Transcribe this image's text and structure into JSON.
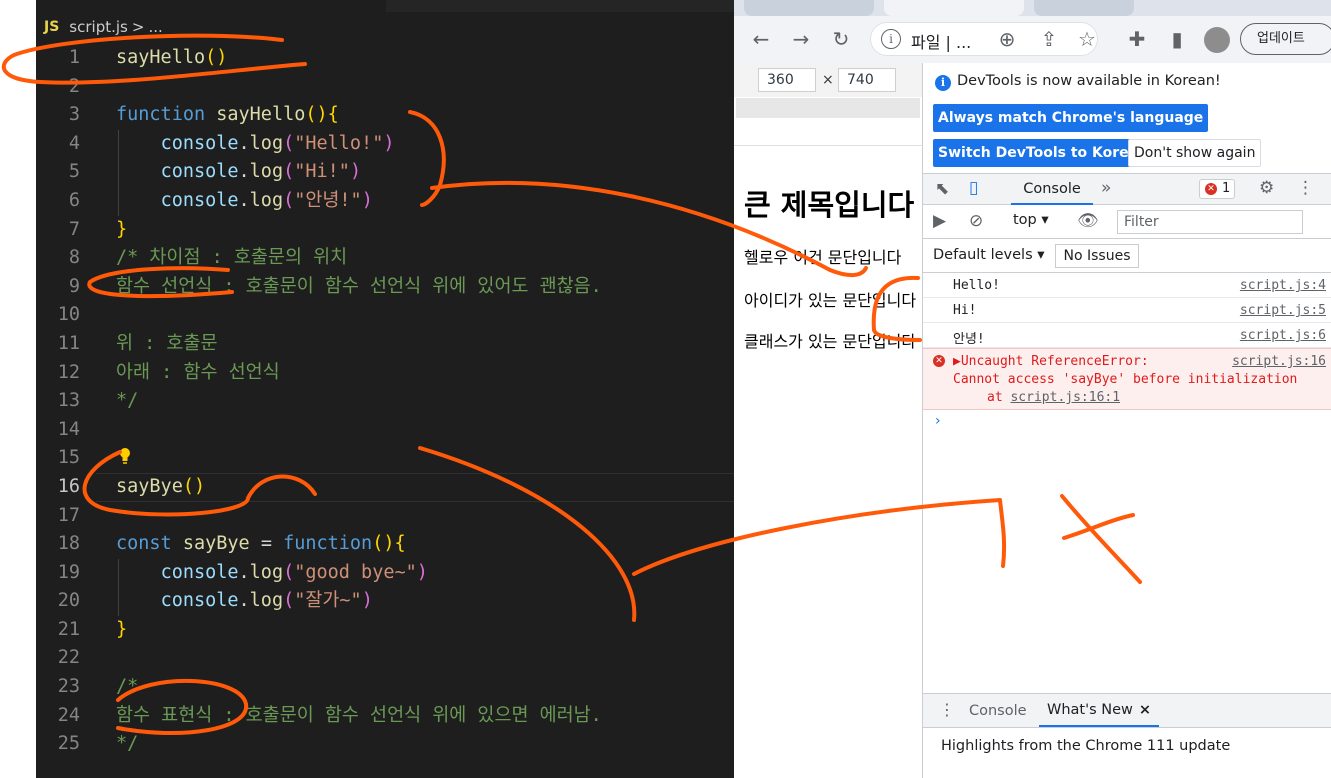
{
  "editor": {
    "breadcrumb": {
      "badge": "JS",
      "file": "script.js",
      "sep": ">",
      "more": "..."
    },
    "lines": [
      {
        "n": "1",
        "html": "<span class=\"fn\">sayHello</span><span class=\"br1\">()</span>"
      },
      {
        "n": "2",
        "html": ""
      },
      {
        "n": "3",
        "html": "<span class=\"kw\">function</span> <span class=\"fn\">sayHello</span><span class=\"br1\">(){</span>"
      },
      {
        "n": "4",
        "html": "    <span class=\"var\">console</span><span class=\"plain\">.</span><span class=\"fn\">log</span><span class=\"br2\">(</span><span class=\"str\">\"Hello!\"</span><span class=\"br2\">)</span>"
      },
      {
        "n": "5",
        "html": "    <span class=\"var\">console</span><span class=\"plain\">.</span><span class=\"fn\">log</span><span class=\"br2\">(</span><span class=\"str\">\"Hi!\"</span><span class=\"br2\">)</span>"
      },
      {
        "n": "6",
        "html": "    <span class=\"var\">console</span><span class=\"plain\">.</span><span class=\"fn\">log</span><span class=\"br2\">(</span><span class=\"str\">\"안녕!\"</span><span class=\"br2\">)</span>"
      },
      {
        "n": "7",
        "html": "<span class=\"br1\">}</span>"
      },
      {
        "n": "8",
        "html": "<span class=\"cm\">/* 차이점 : 호출문의 위치</span>"
      },
      {
        "n": "9",
        "html": "<span class=\"cm\">함수 선언식 : 호출문이 함수 선언식 위에 있어도 괜찮음.</span>"
      },
      {
        "n": "10",
        "html": ""
      },
      {
        "n": "11",
        "html": "<span class=\"cm\">위 : 호출문</span>"
      },
      {
        "n": "12",
        "html": "<span class=\"cm\">아래 : 함수 선언식</span>"
      },
      {
        "n": "13",
        "html": "<span class=\"cm\">*/</span>"
      },
      {
        "n": "14",
        "html": ""
      },
      {
        "n": "15",
        "html": ""
      },
      {
        "n": "16",
        "html": "<span class=\"fn\">sayBye</span><span class=\"br1\">()</span>",
        "active": true
      },
      {
        "n": "17",
        "html": ""
      },
      {
        "n": "18",
        "html": "<span class=\"kw\">const</span> <span class=\"fn\">sayBye</span> <span class=\"plain\">=</span> <span class=\"kw\">function</span><span class=\"br1\">(){</span>"
      },
      {
        "n": "19",
        "html": "    <span class=\"var\">console</span><span class=\"plain\">.</span><span class=\"fn\">log</span><span class=\"br2\">(</span><span class=\"str\">\"good bye~\"</span><span class=\"br2\">)</span>"
      },
      {
        "n": "20",
        "html": "    <span class=\"var\">console</span><span class=\"plain\">.</span><span class=\"fn\">log</span><span class=\"br2\">(</span><span class=\"str\">\"잘가~\"</span><span class=\"br2\">)</span>"
      },
      {
        "n": "21",
        "html": "<span class=\"br1\">}</span>"
      },
      {
        "n": "22",
        "html": ""
      },
      {
        "n": "23",
        "html": "<span class=\"cm\">/*</span>"
      },
      {
        "n": "24",
        "html": "<span class=\"cm\">함수 표현식 : 호출문이 함수 선언식 위에 있으면 에러남.</span>"
      },
      {
        "n": "25",
        "html": "<span class=\"cm\">*/</span>"
      }
    ],
    "indent_lines": [
      "4",
      "5",
      "6",
      "19",
      "20"
    ]
  },
  "browser": {
    "omnibox": {
      "url": "파일 | ..."
    },
    "update_label": "업데이트",
    "viewport": {
      "width": "360",
      "x": "×",
      "height": "740"
    },
    "page": {
      "title": "큰 제목입니다",
      "p1": "헬로우 이건 문단입니다",
      "p2": "아이디가 있는 문단입니다",
      "p3": "클래스가 있는 문단입니다"
    }
  },
  "devtools": {
    "notice": "DevTools is now available in Korean!",
    "btn_match": "Always match Chrome's language",
    "btn_switch": "Switch DevTools to Korean",
    "btn_dont": "Don't show again",
    "tab_console": "Console",
    "more_tabs": "»",
    "error_count": "1",
    "context": "top",
    "filter_placeholder": "Filter",
    "default_levels": "Default levels",
    "no_issues": "No Issues",
    "logs": [
      {
        "msg": "Hello!",
        "src": "script.js:4"
      },
      {
        "msg": "Hi!",
        "src": "script.js:5"
      },
      {
        "msg": "안녕!",
        "src": "script.js:6"
      }
    ],
    "error": {
      "line1": "▶Uncaught ReferenceError:",
      "line2": "Cannot access 'sayBye' before initialization",
      "at": "at",
      "at_link": "script.js:16:1",
      "src": "script.js:16"
    },
    "prompt": "›",
    "drawer": {
      "console": "Console",
      "whats_new": "What's New",
      "close": "×",
      "highlights": "Highlights from the Chrome 111 update"
    }
  },
  "colors": {
    "annotation": "#ff5a0a",
    "editor_bg": "#1e1e1e",
    "accent": "#1a73e8",
    "error": "#d93025"
  }
}
